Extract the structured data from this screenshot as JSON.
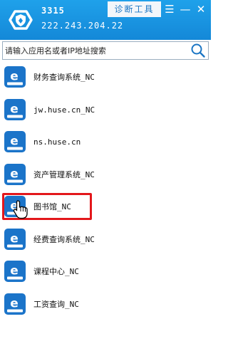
{
  "app": {
    "title": "3315",
    "ip": "222.243.204.22",
    "diagnose_label": "诊断工具",
    "menu_glyph": "☰",
    "minimize_glyph": "—",
    "close_glyph": "✕"
  },
  "search": {
    "placeholder": "请输入应用名或者IP地址搜索"
  },
  "list": {
    "items": [
      {
        "label": "财务查询系统_NC"
      },
      {
        "label": "jw.huse.cn_NC"
      },
      {
        "label": "ns.huse.cn"
      },
      {
        "label": "资产管理系统_NC"
      },
      {
        "label": "图书馆_NC"
      },
      {
        "label": "经费查询系统_NC"
      },
      {
        "label": "课程中心_NC"
      },
      {
        "label": "工资查询_NC"
      }
    ]
  },
  "colors": {
    "header": "#1a97e3",
    "accent": "#1a75c4",
    "highlight": "#e3171b"
  },
  "icons": {
    "logo": "shield-logo-icon",
    "item": "browser-e-icon",
    "search": "magnifier-icon",
    "cursor": "hand-pointer-icon"
  }
}
